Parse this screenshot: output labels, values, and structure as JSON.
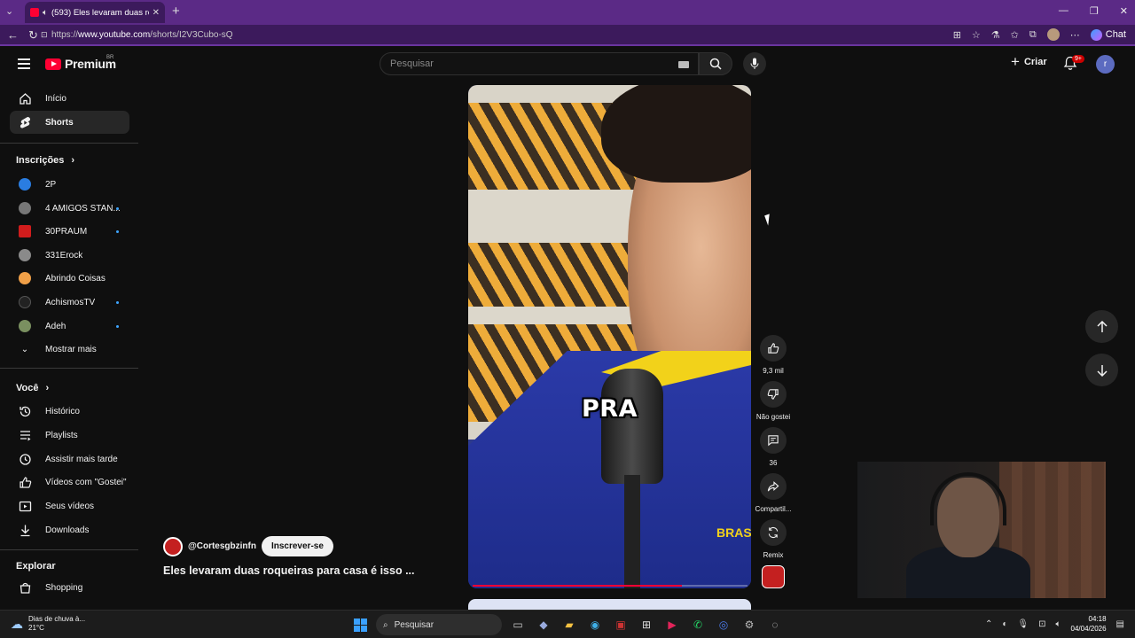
{
  "browser": {
    "tab_title": "(593) Eles levaram duas roquei",
    "url_prefix": "https://",
    "url_domain": "www.youtube.com",
    "url_path": "/shorts/I2V3Cubo-sQ",
    "chat_label": "Chat"
  },
  "header": {
    "logo_text": "Premium",
    "country_code": "BR",
    "search_placeholder": "Pesquisar",
    "create_label": "Criar",
    "notif_badge": "9+",
    "avatar_initial": "r"
  },
  "sidebar": {
    "main": [
      {
        "label": "Início",
        "icon": "home-icon"
      },
      {
        "label": "Shorts",
        "icon": "shorts-icon"
      }
    ],
    "subs_title": "Inscrições",
    "subs": [
      {
        "label": "2P",
        "color": "#2a7de1",
        "dot": false
      },
      {
        "label": "4 AMIGOS STAN...",
        "color": "#777777",
        "dot": true
      },
      {
        "label": "30PRAUM",
        "color": "#d11c1c",
        "dot": true
      },
      {
        "label": "331Erock",
        "color": "#8a8a8a",
        "dot": false
      },
      {
        "label": "Abrindo Coisas",
        "color": "#f0a048",
        "dot": false
      },
      {
        "label": "AchismosTV",
        "color": "#222222",
        "dot": true
      },
      {
        "label": "Adeh",
        "color": "#7a9060",
        "dot": true
      }
    ],
    "show_more": "Mostrar mais",
    "you_title": "Você",
    "you": [
      {
        "label": "Histórico",
        "icon": "history-icon"
      },
      {
        "label": "Playlists",
        "icon": "playlists-icon"
      },
      {
        "label": "Assistir mais tarde",
        "icon": "watch-later-icon"
      },
      {
        "label": "Vídeos com \"Gostei\"",
        "icon": "liked-icon"
      },
      {
        "label": "Seus vídeos",
        "icon": "your-videos-icon"
      },
      {
        "label": "Downloads",
        "icon": "downloads-icon"
      }
    ],
    "explore_title": "Explorar",
    "explore": [
      {
        "label": "Shopping",
        "icon": "shopping-icon"
      }
    ]
  },
  "short": {
    "caption": "PRA",
    "jersey_text": "BRAS",
    "channel_handle": "@Cortesgbzinfn",
    "subscribe_label": "Inscrever-se",
    "title": "Eles levaram duas roqueiras para casa é isso ...",
    "progress": 0.76
  },
  "actions": {
    "likes": "9,3 mil",
    "dislike_label": "Não gostei",
    "comments": "36",
    "share_label": "Compartil...",
    "remix_label": "Remix"
  },
  "taskbar": {
    "weather_title": "Dias de chuva à...",
    "weather_temp": "21°C",
    "search_label": "Pesquisar",
    "time": "04:18",
    "date": "04/04/2026"
  }
}
